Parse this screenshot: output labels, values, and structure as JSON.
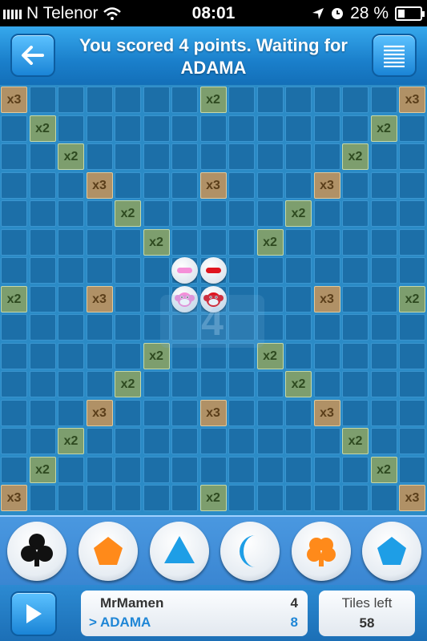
{
  "status_bar": {
    "carrier": "N Telenor",
    "time": "08:01",
    "battery": "28 %"
  },
  "header": {
    "title": "You scored 4 points. Waiting for ADAMA",
    "back_icon": "back-arrow-icon",
    "menu_icon": "menu-lines-icon"
  },
  "board": {
    "size": 15,
    "multipliers": [
      {
        "row": 0,
        "col": 0,
        "label": "x3"
      },
      {
        "row": 0,
        "col": 7,
        "label": "x2"
      },
      {
        "row": 0,
        "col": 14,
        "label": "x3"
      },
      {
        "row": 1,
        "col": 1,
        "label": "x2"
      },
      {
        "row": 1,
        "col": 13,
        "label": "x2"
      },
      {
        "row": 2,
        "col": 2,
        "label": "x2"
      },
      {
        "row": 2,
        "col": 12,
        "label": "x2"
      },
      {
        "row": 3,
        "col": 3,
        "label": "x3"
      },
      {
        "row": 3,
        "col": 7,
        "label": "x3"
      },
      {
        "row": 3,
        "col": 11,
        "label": "x3"
      },
      {
        "row": 4,
        "col": 4,
        "label": "x2"
      },
      {
        "row": 4,
        "col": 10,
        "label": "x2"
      },
      {
        "row": 5,
        "col": 5,
        "label": "x2"
      },
      {
        "row": 5,
        "col": 9,
        "label": "x2"
      },
      {
        "row": 7,
        "col": 0,
        "label": "x2"
      },
      {
        "row": 7,
        "col": 3,
        "label": "x3"
      },
      {
        "row": 7,
        "col": 11,
        "label": "x3"
      },
      {
        "row": 7,
        "col": 14,
        "label": "x2"
      },
      {
        "row": 9,
        "col": 5,
        "label": "x2"
      },
      {
        "row": 9,
        "col": 9,
        "label": "x2"
      },
      {
        "row": 10,
        "col": 4,
        "label": "x2"
      },
      {
        "row": 10,
        "col": 10,
        "label": "x2"
      },
      {
        "row": 11,
        "col": 3,
        "label": "x3"
      },
      {
        "row": 11,
        "col": 7,
        "label": "x3"
      },
      {
        "row": 11,
        "col": 11,
        "label": "x3"
      },
      {
        "row": 12,
        "col": 2,
        "label": "x2"
      },
      {
        "row": 12,
        "col": 12,
        "label": "x2"
      },
      {
        "row": 13,
        "col": 1,
        "label": "x2"
      },
      {
        "row": 13,
        "col": 13,
        "label": "x2"
      },
      {
        "row": 14,
        "col": 0,
        "label": "x3"
      },
      {
        "row": 14,
        "col": 7,
        "label": "x2"
      },
      {
        "row": 14,
        "col": 14,
        "label": "x3"
      }
    ],
    "placed_pieces": [
      {
        "row": 6,
        "col": 6,
        "shape": "minus",
        "color": "#f58fd8"
      },
      {
        "row": 6,
        "col": 7,
        "shape": "minus",
        "color": "#e0141e"
      },
      {
        "row": 7,
        "col": 6,
        "shape": "monkey",
        "color": "#f58fd8"
      },
      {
        "row": 7,
        "col": 7,
        "shape": "monkey",
        "color": "#e0141e"
      }
    ],
    "center_watermark": "4"
  },
  "tray": {
    "tiles": [
      {
        "shape": "club",
        "color": "#111111"
      },
      {
        "shape": "pentagon",
        "color": "#ff8a1a"
      },
      {
        "shape": "triangle",
        "color": "#1e9ee6"
      },
      {
        "shape": "crescent",
        "color": "#1e9ee6"
      },
      {
        "shape": "clover",
        "color": "#ff8a1a"
      },
      {
        "shape": "pentagon",
        "color": "#1e9ee6"
      }
    ]
  },
  "footer": {
    "play_icon": "play-icon",
    "players": [
      {
        "name": "MrMamen",
        "score": "4",
        "active": false
      },
      {
        "name": "ADAMA",
        "score": "8",
        "active": true
      }
    ],
    "turn_marker": ">",
    "tiles_left_label": "Tiles left",
    "tiles_left": "58"
  },
  "colors": {
    "board_bg": "#2b8bc6",
    "cell": "#1c6fa8",
    "x2": "#7d9e6e",
    "x3": "#b09166",
    "active_player": "#1f86d6"
  }
}
